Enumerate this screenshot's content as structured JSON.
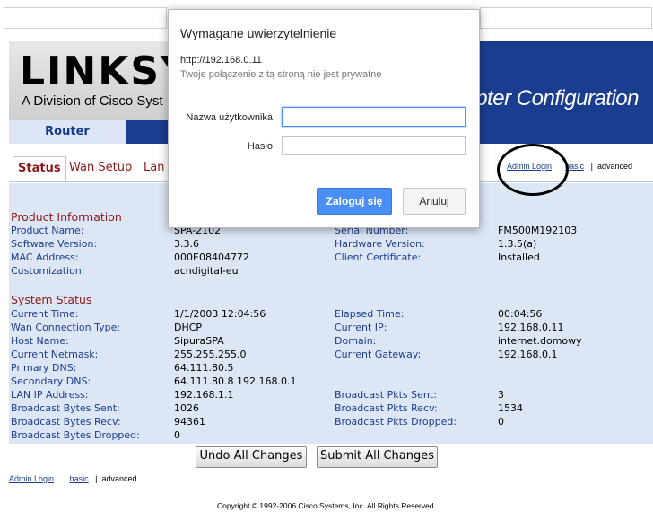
{
  "banner": {
    "logo": "LINKSY",
    "logo_sub": "A Division of Cisco Syst",
    "title": "apter Configuration"
  },
  "nav": {
    "router_tab": "Router"
  },
  "tabs": [
    {
      "label": "Status"
    },
    {
      "label": "Wan Setup"
    },
    {
      "label": "Lan"
    }
  ],
  "right_links": {
    "admin_login": "Admin Login",
    "basic": "basic",
    "sep": "|",
    "advanced": "advanced"
  },
  "product_info": {
    "title": "Product Information",
    "rows": [
      {
        "k1": "Product Name:",
        "v1": "SPA-2102",
        "k2": "Serial Number:",
        "v2": "FM500M192103"
      },
      {
        "k1": "Software Version:",
        "v1": "3.3.6",
        "k2": "Hardware Version:",
        "v2": "1.3.5(a)"
      },
      {
        "k1": "MAC Address:",
        "v1": "000E08404772",
        "k2": "Client Certificate:",
        "v2": "Installed"
      },
      {
        "k1": "Customization:",
        "v1": "acndigital-eu",
        "k2": "",
        "v2": ""
      }
    ]
  },
  "system_status": {
    "title": "System Status",
    "rows": [
      {
        "k1": "Current Time:",
        "v1": "1/1/2003 12:04:56",
        "k2": "Elapsed Time:",
        "v2": "00:04:56"
      },
      {
        "k1": "Wan Connection Type:",
        "v1": "DHCP",
        "k2": "Current IP:",
        "v2": "192.168.0.11"
      },
      {
        "k1": "Host Name:",
        "v1": "SipuraSPA",
        "k2": "Domain:",
        "v2": "internet.domowy"
      },
      {
        "k1": "Current Netmask:",
        "v1": "255.255.255.0",
        "k2": "Current Gateway:",
        "v2": "192.168.0.1"
      },
      {
        "k1": "Primary DNS:",
        "v1": "64.111.80.5",
        "k2": "",
        "v2": ""
      },
      {
        "k1": "Secondary DNS:",
        "v1": "64.111.80.8 192.168.0.1",
        "k2": "",
        "v2": ""
      },
      {
        "k1": "LAN IP Address:",
        "v1": "192.168.1.1",
        "k2": "Broadcast Pkts Sent:",
        "v2": "3"
      },
      {
        "k1": "Broadcast Bytes Sent:",
        "v1": "1026",
        "k2": "Broadcast Pkts Recv:",
        "v2": "1534"
      },
      {
        "k1": "Broadcast Bytes Recv:",
        "v1": "94361",
        "k2": "Broadcast Pkts Dropped:",
        "v2": "0"
      },
      {
        "k1": "Broadcast Bytes Dropped:",
        "v1": "0",
        "k2": "",
        "v2": ""
      }
    ]
  },
  "buttons": {
    "undo": "Undo All Changes",
    "submit": "Submit All Changes"
  },
  "bottom_links": {
    "admin_login": "Admin Login",
    "basic": "basic",
    "sep": "|",
    "advanced": "advanced"
  },
  "copyright": "Copyright © 1992-2006 Cisco Systems, Inc. All Rights Reserved.",
  "dialog": {
    "title": "Wymagane uwierzytelnienie",
    "url": "http://192.168.0.11",
    "note": "Twoje połączenie z tą stroną nie jest prywatne",
    "username_label": "Nazwa użytkownika",
    "username_value": "",
    "password_label": "Hasło",
    "password_value": "",
    "login_button": "Zaloguj się",
    "cancel_button": "Anuluj"
  }
}
